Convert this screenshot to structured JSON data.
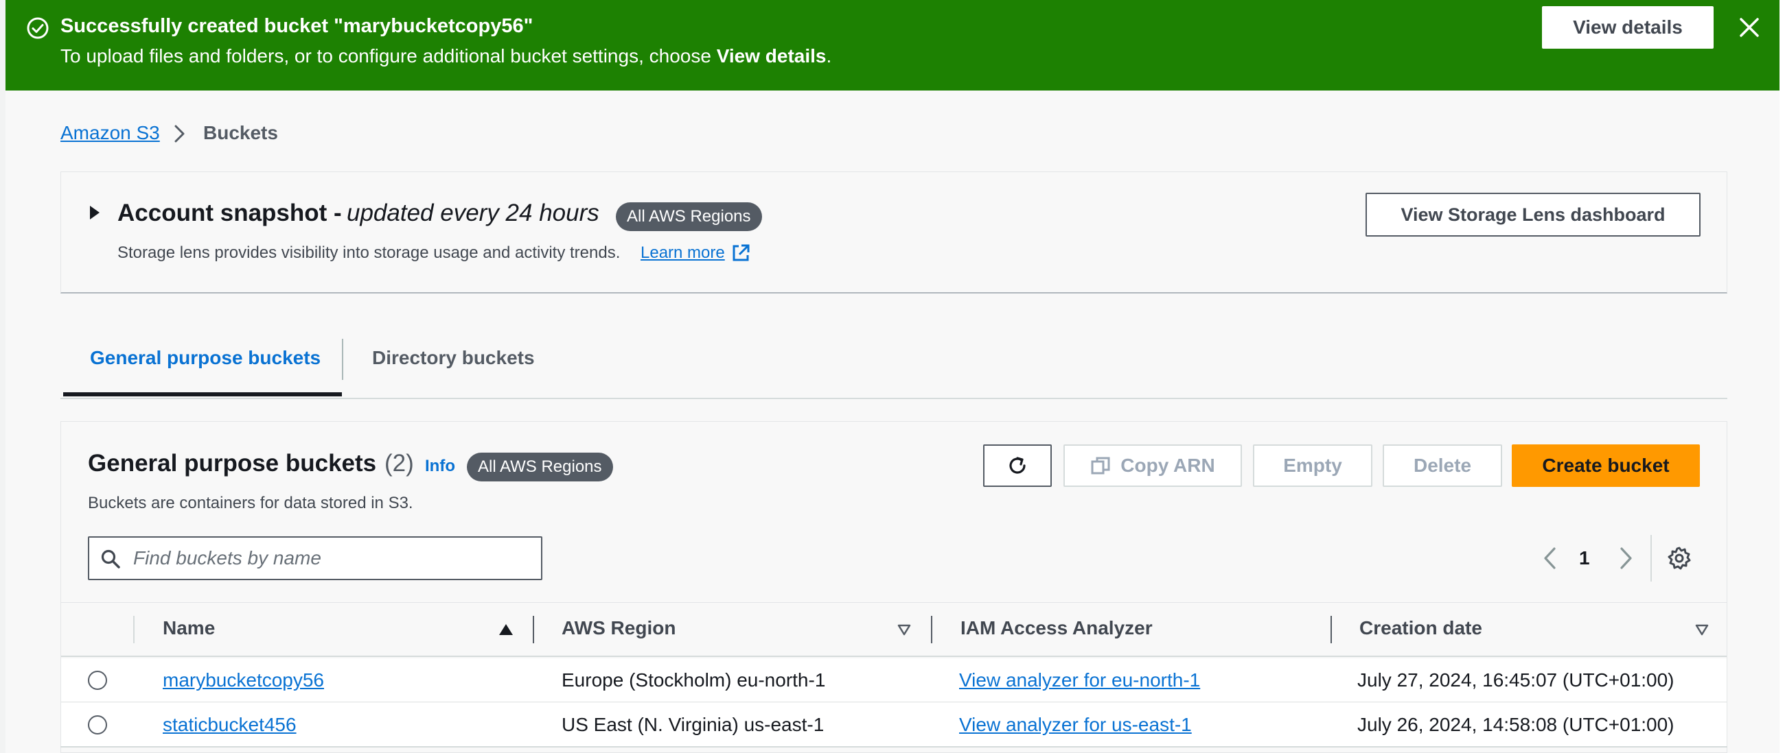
{
  "flash": {
    "title": "Successfully created bucket \"marybucketcopy56\"",
    "message_prefix": "To upload files and folders, or to configure additional bucket settings, choose ",
    "message_strong": "View details",
    "message_suffix": ".",
    "view_details_label": "View details",
    "icons": {
      "status": "check-circle-icon",
      "dismiss": "close-icon"
    },
    "color": "#1d8102"
  },
  "breadcrumb": {
    "root_label": "Amazon S3",
    "current_label": "Buckets"
  },
  "snapshot": {
    "title": "Account snapshot - ",
    "subtitle": "updated every 24 hours",
    "badge": "All AWS Regions",
    "description": "Storage lens provides visibility into storage usage and activity trends.",
    "learn_more": "Learn more",
    "dashboard_button": "View Storage Lens dashboard"
  },
  "tabs": [
    {
      "label": "General purpose buckets",
      "active": true
    },
    {
      "label": "Directory buckets",
      "active": false
    }
  ],
  "panel": {
    "title": "General purpose buckets",
    "count": "(2)",
    "info": "Info",
    "badge": "All AWS Regions",
    "description": "Buckets are containers for data stored in S3.",
    "buttons": {
      "refresh": "refresh-icon",
      "copy_arn": "Copy ARN",
      "empty": "Empty",
      "delete": "Delete",
      "create": "Create bucket"
    },
    "search_placeholder": "Find buckets by name",
    "search_value": "",
    "page": "1",
    "accent_color": "#ff9900"
  },
  "table": {
    "columns": [
      "Name",
      "AWS Region",
      "IAM Access Analyzer",
      "Creation date"
    ],
    "rows": [
      {
        "name": "marybucketcopy56",
        "region": "Europe (Stockholm) eu-north-1",
        "analyzer": "View analyzer for eu-north-1",
        "created": "July 27, 2024, 16:45:07 (UTC+01:00)"
      },
      {
        "name": "staticbucket456",
        "region": "US East (N. Virginia) us-east-1",
        "analyzer": "View analyzer for us-east-1",
        "created": "July 26, 2024, 14:58:08 (UTC+01:00)"
      }
    ]
  }
}
